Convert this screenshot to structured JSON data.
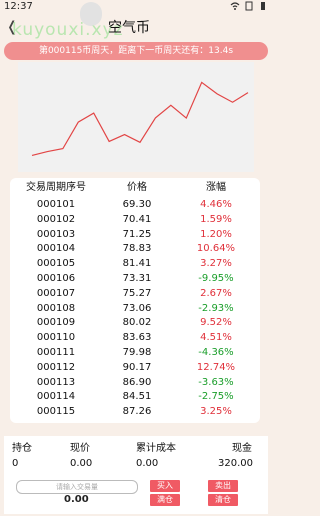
{
  "status": {
    "time": "12:37"
  },
  "app": {
    "title": "空气币",
    "watermark": "kuyouxi.xyz",
    "banner": "第000115币周天，距离下一币周天还有：13.4s"
  },
  "colors": {
    "up": "#e0303a",
    "down": "#1a9e2a",
    "line": "#e24545"
  },
  "chart_data": {
    "type": "line",
    "x": [
      "000101",
      "000102",
      "000103",
      "000104",
      "000105",
      "000106",
      "000107",
      "000108",
      "000109",
      "000110",
      "000111",
      "000112",
      "000113",
      "000114",
      "000115"
    ],
    "series": [
      {
        "values": [
          69.3,
          70.41,
          71.25,
          78.83,
          81.41,
          73.31,
          75.27,
          73.06,
          80.02,
          83.63,
          79.98,
          90.17,
          86.9,
          84.51,
          87.26
        ]
      }
    ]
  },
  "table": {
    "headers": [
      "交易周期序号",
      "价格",
      "涨幅"
    ],
    "rows": [
      {
        "id": "000101",
        "price": "69.30",
        "change": "4.46%",
        "dir": "up"
      },
      {
        "id": "000102",
        "price": "70.41",
        "change": "1.59%",
        "dir": "up"
      },
      {
        "id": "000103",
        "price": "71.25",
        "change": "1.20%",
        "dir": "up"
      },
      {
        "id": "000104",
        "price": "78.83",
        "change": "10.64%",
        "dir": "up"
      },
      {
        "id": "000105",
        "price": "81.41",
        "change": "3.27%",
        "dir": "up"
      },
      {
        "id": "000106",
        "price": "73.31",
        "change": "-9.95%",
        "dir": "down"
      },
      {
        "id": "000107",
        "price": "75.27",
        "change": "2.67%",
        "dir": "up"
      },
      {
        "id": "000108",
        "price": "73.06",
        "change": "-2.93%",
        "dir": "down"
      },
      {
        "id": "000109",
        "price": "80.02",
        "change": "9.52%",
        "dir": "up"
      },
      {
        "id": "000110",
        "price": "83.63",
        "change": "4.51%",
        "dir": "up"
      },
      {
        "id": "000111",
        "price": "79.98",
        "change": "-4.36%",
        "dir": "down"
      },
      {
        "id": "000112",
        "price": "90.17",
        "change": "12.74%",
        "dir": "up"
      },
      {
        "id": "000113",
        "price": "86.90",
        "change": "-3.63%",
        "dir": "down"
      },
      {
        "id": "000114",
        "price": "84.51",
        "change": "-2.75%",
        "dir": "down"
      },
      {
        "id": "000115",
        "price": "87.26",
        "change": "3.25%",
        "dir": "up"
      }
    ]
  },
  "panel": {
    "headers": {
      "hold": "持仓",
      "price": "现价",
      "cost": "累计成本",
      "cash": "现金"
    },
    "values": {
      "hold": "0",
      "price": "0.00",
      "cost": "0.00",
      "cash": "320.00"
    },
    "input_placeholder": "请输入交易量",
    "quantity": "0.00",
    "buttons": {
      "buy": "买入",
      "sell": "卖出",
      "full_buy": "满仓",
      "clear": "清仓"
    }
  }
}
